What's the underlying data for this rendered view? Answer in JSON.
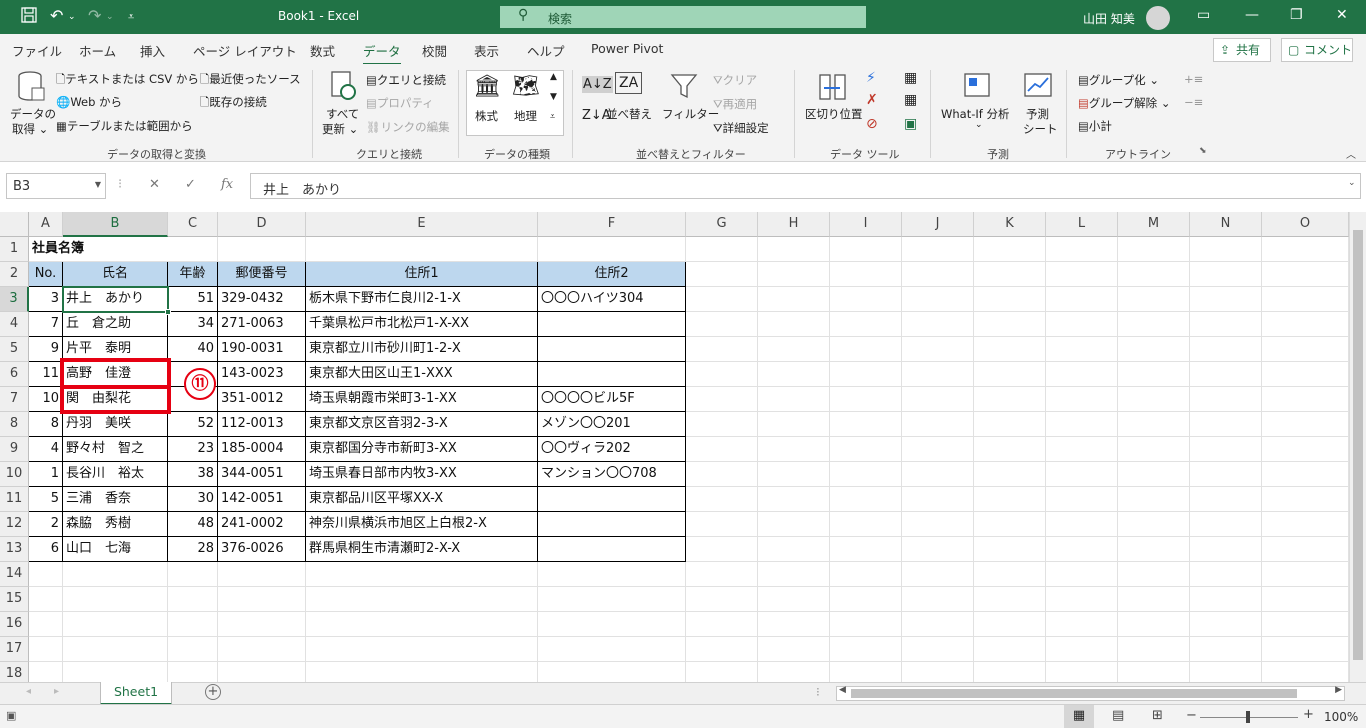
{
  "titlebar": {
    "save_icon": "save-icon",
    "undo_icon": "undo-icon",
    "redo_icon": "redo-icon",
    "customize_icon": "customize-qat-icon",
    "title": "Book1 - Excel",
    "search_icon": "search-icon",
    "search_placeholder": "検索",
    "user": "山田 知美",
    "accent": "#217346"
  },
  "menu": {
    "tabs": [
      "ファイル",
      "ホーム",
      "挿入",
      "ページ レイアウト",
      "数式",
      "データ",
      "校閲",
      "表示",
      "ヘルプ",
      "Power Pivot"
    ],
    "active": "データ",
    "share": "共有",
    "comment": "コメント"
  },
  "ribbon": {
    "get_data": "データの取得",
    "get_data_sub": "取得 ⌄",
    "get_data_line1": "データの",
    "from_text_csv": "テキストまたは CSV から",
    "from_web": "Web から",
    "from_table": "テーブルまたは範囲から",
    "recent_sources": "最近使ったソース",
    "existing_conn": "既存の接続",
    "group1": "データの取得と変換",
    "refresh_all_1": "すべて",
    "refresh_all_2": "更新 ⌄",
    "queries_conn": "クエリと接続",
    "properties": "プロパティ",
    "edit_links": "リンクの編集",
    "group2": "クエリと接続",
    "stocks": "株式",
    "geography": "地理",
    "group3": "データの種類",
    "sort": "並べ替え",
    "filter": "フィルター",
    "clear": "クリア",
    "reapply": "再適用",
    "advanced": "詳細設定",
    "group4": "並べ替えとフィルター",
    "text_to_cols": "区切り位置",
    "group5": "データ ツール",
    "whatif": "What-If 分析",
    "whatif_sub": "⌄",
    "forecast_1": "予測",
    "forecast_2": "シート",
    "group6": "予測",
    "group_btn": "グループ化",
    "ungroup_btn": "グループ解除",
    "subtotal": "小計",
    "group7": "アウトライン"
  },
  "formula": {
    "namebox": "B3",
    "fx": "fx",
    "value": "井上　あかり"
  },
  "columns": [
    "A",
    "B",
    "C",
    "D",
    "E",
    "F",
    "G",
    "H",
    "I",
    "J",
    "K",
    "L",
    "M",
    "N",
    "O"
  ],
  "rows": [
    "1",
    "2",
    "3",
    "4",
    "5",
    "6",
    "7",
    "8",
    "9",
    "10",
    "11",
    "12",
    "13",
    "14",
    "15",
    "16",
    "17",
    "18"
  ],
  "sheet": {
    "title": "社員名簿",
    "headers": [
      "No.",
      "氏名",
      "年齢",
      "郵便番号",
      "住所1",
      "住所2"
    ],
    "data": [
      [
        "3",
        "井上　あかり",
        "51",
        "329-0432",
        "栃木県下野市仁良川2-1-X",
        "〇〇〇ハイツ304"
      ],
      [
        "7",
        "丘　倉之助",
        "34",
        "271-0063",
        "千葉県松戸市北松戸1-X-XX",
        ""
      ],
      [
        "9",
        "片平　泰明",
        "40",
        "190-0031",
        "東京都立川市砂川町1-2-X",
        ""
      ],
      [
        "11",
        "高野　佳澄",
        "",
        "143-0023",
        "東京都大田区山王1-XXX",
        ""
      ],
      [
        "10",
        "関　由梨花",
        "",
        "351-0012",
        "埼玉県朝霞市栄町3-1-XX",
        "〇〇〇〇ビル5F"
      ],
      [
        "8",
        "丹羽　美咲",
        "52",
        "112-0013",
        "東京都文京区音羽2-3-X",
        "メゾン〇〇201"
      ],
      [
        "4",
        "野々村　智之",
        "23",
        "185-0004",
        "東京都国分寺市新町3-XX",
        "〇〇ヴィラ202"
      ],
      [
        "1",
        "長谷川　裕太",
        "38",
        "344-0051",
        "埼玉県春日部市内牧3-XX",
        "マンション〇〇708"
      ],
      [
        "5",
        "三浦　香奈",
        "30",
        "142-0051",
        "東京都品川区平塚XX-X",
        ""
      ],
      [
        "2",
        "森脇　秀樹",
        "48",
        "241-0002",
        "神奈川県横浜市旭区上白根2-X",
        ""
      ],
      [
        "6",
        "山口　七海",
        "28",
        "376-0026",
        "群馬県桐生市清瀬町2-X-X",
        ""
      ]
    ]
  },
  "annotation": {
    "badge": "⑪"
  },
  "sheettab": "Sheet1",
  "status": {
    "zoom": "100%"
  }
}
